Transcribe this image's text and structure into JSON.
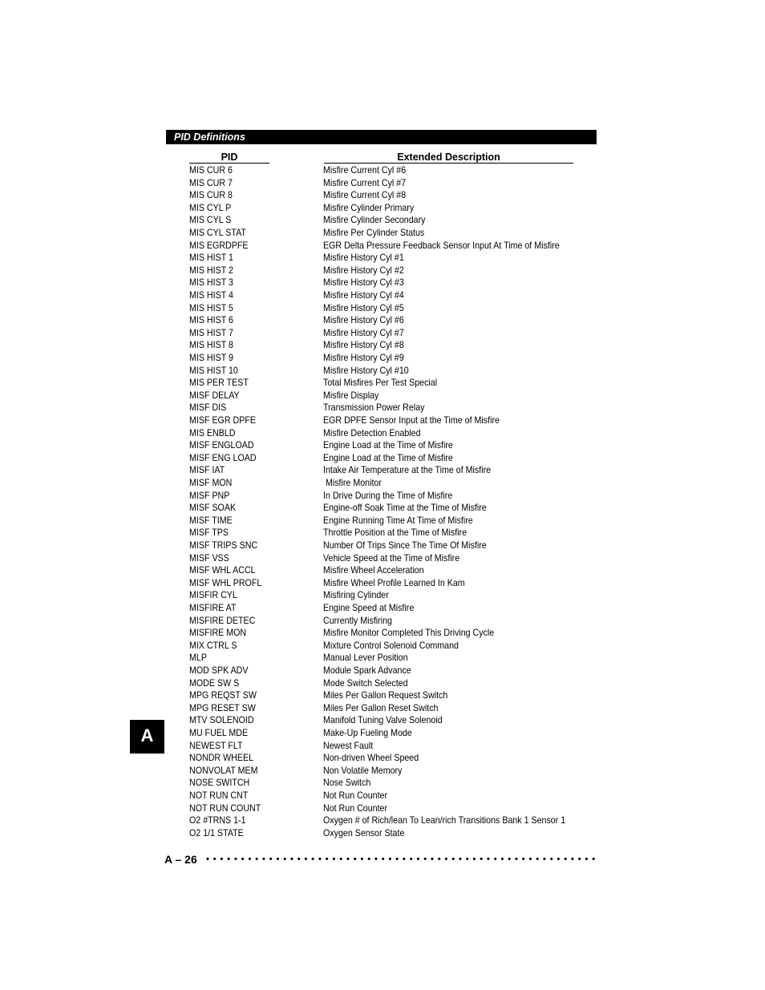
{
  "header": {
    "title": "PID Definitions"
  },
  "columns": {
    "pid": "PID",
    "description": "Extended Description"
  },
  "rows": [
    {
      "pid": "MIS CUR 6",
      "desc": "Misfire Current Cyl #6"
    },
    {
      "pid": "MIS CUR 7",
      "desc": "Misfire Current Cyl #7"
    },
    {
      "pid": "MIS CUR 8",
      "desc": "Misfire Current Cyl #8"
    },
    {
      "pid": "MIS CYL P",
      "desc": "Misfire Cylinder Primary"
    },
    {
      "pid": "MIS CYL S",
      "desc": "Misfire Cylinder Secondary"
    },
    {
      "pid": "MIS CYL STAT",
      "desc": "Misfire Per Cylinder Status"
    },
    {
      "pid": "MIS EGRDPFE",
      "desc": "EGR Delta Pressure Feedback Sensor Input At Time of Misfire"
    },
    {
      "pid": "MIS HIST 1",
      "desc": "Misfire History Cyl #1"
    },
    {
      "pid": "MIS HIST 2",
      "desc": "Misfire History Cyl #2"
    },
    {
      "pid": "MIS HIST 3",
      "desc": "Misfire History Cyl #3"
    },
    {
      "pid": "MIS HIST 4",
      "desc": "Misfire History Cyl #4"
    },
    {
      "pid": "MIS HIST 5",
      "desc": "Misfire History Cyl #5"
    },
    {
      "pid": "MIS HIST 6",
      "desc": "Misfire History Cyl #6"
    },
    {
      "pid": "MIS HIST 7",
      "desc": "Misfire History Cyl #7"
    },
    {
      "pid": "MIS HIST 8",
      "desc": "Misfire History Cyl #8"
    },
    {
      "pid": "MIS HIST 9",
      "desc": "Misfire History Cyl #9"
    },
    {
      "pid": "MIS HIST 10",
      "desc": "Misfire History Cyl #10"
    },
    {
      "pid": "MIS PER TEST",
      "desc": "Total Misfires Per Test Special"
    },
    {
      "pid": "MISF DELAY",
      "desc": "Misfire Display"
    },
    {
      "pid": "MISF DIS",
      "desc": "Transmission Power Relay"
    },
    {
      "pid": "MISF EGR DPFE",
      "desc": "EGR DPFE Sensor Input at the Time of Misfire"
    },
    {
      "pid": "MIS ENBLD",
      "desc": "Misfire Detection Enabled"
    },
    {
      "pid": "MISF ENGLOAD",
      "desc": "Engine Load at the Time of Misfire"
    },
    {
      "pid": "MISF ENG LOAD",
      "desc": "Engine Load at the Time of Misfire"
    },
    {
      "pid": "MISF IAT",
      "desc": "Intake Air Temperature at the Time of Misfire"
    },
    {
      "pid": "MISF MON",
      "desc": " Misfire Monitor"
    },
    {
      "pid": "MISF PNP",
      "desc": "In Drive During the Time of Misfire"
    },
    {
      "pid": "MISF SOAK",
      "desc": "Engine-off Soak Time at the Time of Misfire"
    },
    {
      "pid": "MISF TIME",
      "desc": "Engine Running Time At Time of Misfire"
    },
    {
      "pid": "MISF TPS",
      "desc": "Throttle Position at the Time of Misfire"
    },
    {
      "pid": "MISF TRIPS SNC",
      "desc": "Number Of Trips Since The Time Of Misfire"
    },
    {
      "pid": "MISF VSS",
      "desc": "Vehicle Speed at the Time of Misfire"
    },
    {
      "pid": "MISF WHL ACCL",
      "desc": "Misfire Wheel Acceleration"
    },
    {
      "pid": "MISF WHL PROFL",
      "desc": "Misfire Wheel Profile Learned In Kam"
    },
    {
      "pid": "MISFIR CYL",
      "desc": "Misfiring Cylinder"
    },
    {
      "pid": "MISFIRE AT",
      "desc": "Engine Speed at Misfire"
    },
    {
      "pid": "MISFIRE DETEC",
      "desc": "Currently Misfiring"
    },
    {
      "pid": "MISFIRE MON",
      "desc": "Misfire Monitor Completed This Driving Cycle"
    },
    {
      "pid": "MIX CTRL S",
      "desc": "Mixture Control Solenoid Command"
    },
    {
      "pid": "MLP",
      "desc": "Manual Lever Position"
    },
    {
      "pid": "MOD SPK ADV",
      "desc": "Module Spark Advance"
    },
    {
      "pid": "MODE SW S",
      "desc": "Mode Switch Selected"
    },
    {
      "pid": "MPG REQST SW",
      "desc": "Miles Per Gallon Request Switch"
    },
    {
      "pid": "MPG RESET SW",
      "desc": "Miles Per Gallon Reset Switch"
    },
    {
      "pid": "MTV SOLENOID",
      "desc": "Manifold Tuning Valve Solenoid"
    },
    {
      "pid": "MU FUEL MDE",
      "desc": "Make-Up Fueling Mode"
    },
    {
      "pid": "NEWEST FLT",
      "desc": "Newest Fault"
    },
    {
      "pid": "NONDR WHEEL",
      "desc": "Non-driven Wheel Speed"
    },
    {
      "pid": "NONVOLAT MEM",
      "desc": "Non Volatile Memory"
    },
    {
      "pid": "NOSE SWITCH",
      "desc": "Nose Switch"
    },
    {
      "pid": "NOT RUN CNT",
      "desc": "Not Run Counter"
    },
    {
      "pid": "NOT RUN COUNT",
      "desc": "Not Run Counter"
    },
    {
      "pid": "O2 #TRNS 1-1",
      "desc": "Oxygen # of Rich/lean To Lean/rich Transitions Bank 1 Sensor 1"
    },
    {
      "pid": "O2 1/1 STATE",
      "desc": "Oxygen Sensor State"
    }
  ],
  "side_tab": {
    "letter": "A"
  },
  "footer": {
    "page_number": "A – 26",
    "dots": "••••••••••••••••••••••••••••••••••••••••••••••••••••••••••••••"
  }
}
